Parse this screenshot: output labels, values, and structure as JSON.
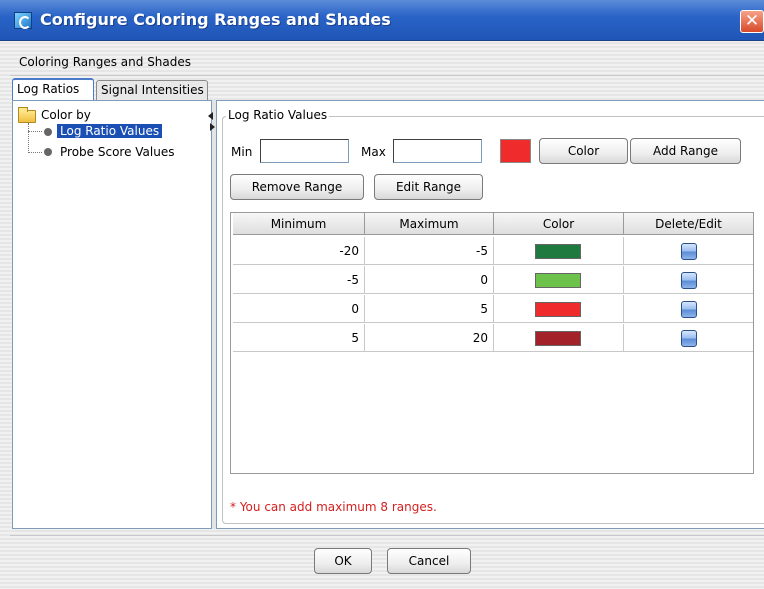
{
  "window": {
    "title": "Configure Coloring Ranges and Shades",
    "close_glyph": "✕"
  },
  "subtitle": "Coloring Ranges and Shades",
  "tabs": [
    {
      "label": "Log Ratios",
      "active": true
    },
    {
      "label": "Signal Intensities",
      "active": false
    }
  ],
  "tree": {
    "root": "Color by",
    "items": [
      {
        "label": "Log Ratio Values",
        "selected": true
      },
      {
        "label": "Probe Score Values",
        "selected": false
      }
    ]
  },
  "group": {
    "title": "Log Ratio Values",
    "min_label": "Min",
    "max_label": "Max",
    "min_value": "",
    "max_value": "",
    "selected_color": "#ef2b2b",
    "color_button": "Color",
    "add_range_button": "Add Range",
    "remove_range_button": "Remove Range",
    "edit_range_button": "Edit Range"
  },
  "table": {
    "columns": [
      "Minimum",
      "Maximum",
      "Color",
      "Delete/Edit"
    ],
    "rows": [
      {
        "min": "-20",
        "max": "-5",
        "color": "#1e7a3e"
      },
      {
        "min": "-5",
        "max": "0",
        "color": "#6cc24a"
      },
      {
        "min": "0",
        "max": "5",
        "color": "#ef2b2b"
      },
      {
        "min": "5",
        "max": "20",
        "color": "#a3222a"
      }
    ]
  },
  "footnote": "* You can add maximum 8 ranges.",
  "footer": {
    "ok_button": "OK",
    "cancel_button": "Cancel"
  }
}
